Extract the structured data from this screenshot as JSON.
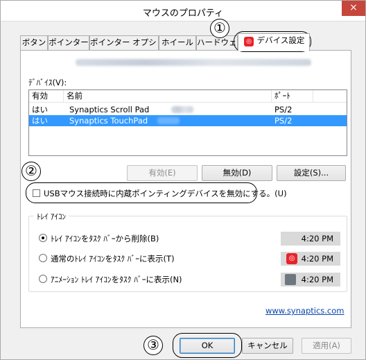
{
  "window": {
    "title": "マウスのプロパティ",
    "close_label": "×"
  },
  "tabs": [
    {
      "label": "ボタン"
    },
    {
      "label": "ポインター"
    },
    {
      "label": "ポインター オプション"
    },
    {
      "label": "ホイール"
    },
    {
      "label": "ハードウェア"
    },
    {
      "label": "デバイス設定",
      "active": true
    }
  ],
  "device_section": {
    "label": "ﾃﾞﾊﾞｲｽ(V):"
  },
  "device_list": {
    "headers": [
      "有効",
      "名前",
      "ﾎﾟｰﾄ"
    ],
    "rows": [
      {
        "enabled": "はい",
        "name": "Synaptics Scroll Pad",
        "port": "PS/2",
        "selected": false
      },
      {
        "enabled": "はい",
        "name": "Synaptics TouchPad",
        "port": "PS/2",
        "selected": true
      }
    ]
  },
  "buttons": {
    "enable": "有効(E)",
    "disable": "無効(D)",
    "settings": "設定(S)..."
  },
  "usb_checkbox": {
    "label": "USBマウス接続時に内蔵ポインティングデバイスを無効にする。(U)",
    "checked": false
  },
  "tray_group": {
    "legend": "ﾄﾚｲ ｱｲｺﾝ",
    "options": [
      {
        "label": "ﾄﾚｲ ｱｲｺﾝをﾀｽｸ ﾊﾞｰから削除(B)",
        "checked": true,
        "time": "4:20 PM",
        "icon": "none"
      },
      {
        "label": "通常のﾄﾚｲ ｱｲｺﾝをﾀｽｸ ﾊﾞｰに表示(T)",
        "checked": false,
        "time": "4:20 PM",
        "icon": "synaptics-red-icon"
      },
      {
        "label": "ｱﾆﾒｰｼｮﾝ ﾄﾚｲ ｱｲｺﾝをﾀｽｸ ﾊﾞｰに表示(N)",
        "checked": false,
        "time": "4:20 PM",
        "icon": "animated-touchpad-icon"
      }
    ]
  },
  "link": {
    "text": "www.synaptics.com"
  },
  "footer": {
    "ok": "OK",
    "cancel": "キャンセル",
    "apply": "適用(A)"
  },
  "callouts": [
    "①",
    "②",
    "③"
  ],
  "colors": {
    "selection": "#3399ff",
    "close_button": "#c7463c",
    "link": "#0645ad",
    "synaptics_red": "#e8232a"
  }
}
